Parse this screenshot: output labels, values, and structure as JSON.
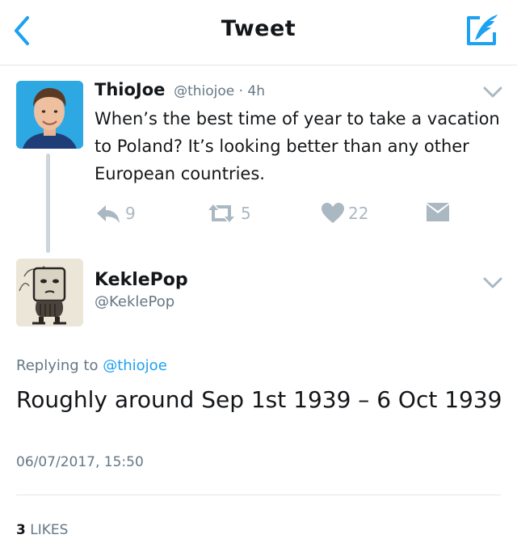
{
  "header": {
    "title": "Tweet",
    "back_icon": "back-chevron-icon",
    "compose_icon": "compose-tweet-icon",
    "accent": "#1da1f2"
  },
  "parent_tweet": {
    "name": "ThioJoe",
    "handle": "@thiojoe",
    "meta": "@thiojoe · 4h",
    "text": "When’s the best time of year to take a vacation to Poland? It’s looking better than any other European countries.",
    "actions": {
      "reply_count": "9",
      "retweet_count": "5",
      "like_count": "22"
    }
  },
  "reply_tweet": {
    "name": "KeklePop",
    "handle": "@KeklePop",
    "replying_prefix": "Replying to ",
    "replying_to": "@thiojoe",
    "text": "Roughly around Sep 1st 1939 – 6 Oct 1939",
    "timestamp": "06/07/2017, 15:50",
    "likes_count": "3",
    "likes_label": " LIKES"
  },
  "colors": {
    "text": "#14171a",
    "muted": "#657786",
    "action_gray": "#aab8c2",
    "divider": "#e1e8ed"
  }
}
